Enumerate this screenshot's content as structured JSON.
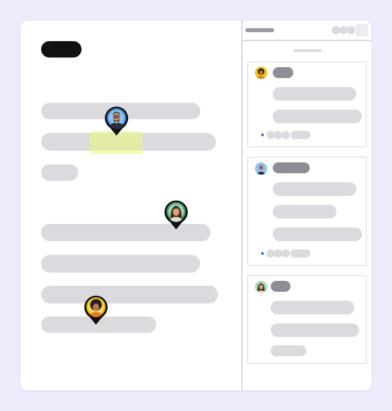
{
  "colors": {
    "background": "#ececfd",
    "card": "#ffffff",
    "placeholder": "#dadadf",
    "title_pill": "#111111",
    "highlight": "#eefa78",
    "name_pill": "#8e8e96",
    "reply_bullet": "#2673dd"
  },
  "document": {
    "title": "",
    "lines": [
      "",
      "",
      "",
      "",
      "",
      "",
      "",
      ""
    ]
  },
  "collaborators": [
    {
      "id": "man-with-glasses",
      "ring": "#3f8ed8",
      "icon": "avatar-man-glasses-icon"
    },
    {
      "id": "woman-long-hair",
      "ring": "#3e9a6c",
      "icon": "avatar-woman-icon"
    },
    {
      "id": "woman-curly-hair",
      "ring": "#f2c20d",
      "icon": "avatar-woman-curly-icon"
    }
  ],
  "comments_panel": {
    "title": "",
    "threads": [
      {
        "author": "woman-curly-hair",
        "lines": [
          "",
          ""
        ],
        "has_replies": true
      },
      {
        "author": "man-with-glasses",
        "lines": [
          "",
          "",
          ""
        ],
        "has_replies": true
      },
      {
        "author": "woman-long-hair",
        "lines": [
          "",
          "",
          ""
        ],
        "has_replies": false
      }
    ]
  }
}
